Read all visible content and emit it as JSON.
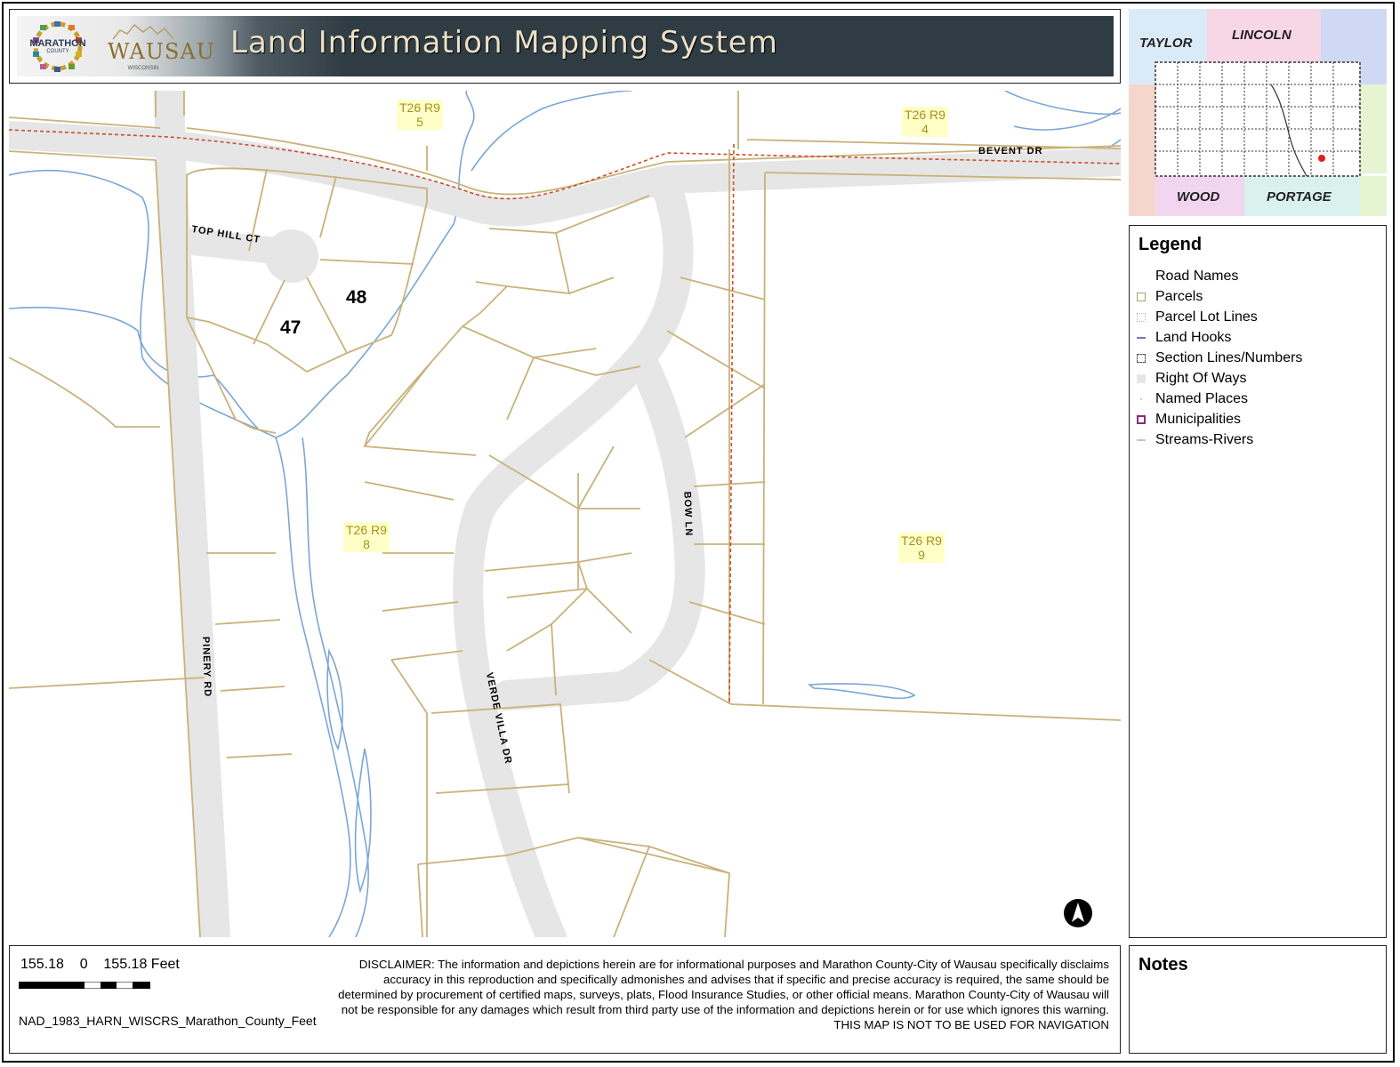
{
  "header": {
    "title": "Land Information Mapping System",
    "logo_marathon": "MARATHON",
    "logo_marathon_sub": "COUNTY",
    "logo_wausau": "WAUSAU",
    "logo_wausau_sub": "WISCONSIN"
  },
  "map": {
    "section_labels": [
      {
        "line1": "T26 R9",
        "line2": "5"
      },
      {
        "line1": "T26 R9",
        "line2": "4"
      },
      {
        "line1": "T26 R9",
        "line2": "8"
      },
      {
        "line1": "T26 R9",
        "line2": "9"
      }
    ],
    "road_labels": [
      "TOP HILL CT",
      "BEVENT DR",
      "BOW LN",
      "PINERY RD",
      "VERDE VILLA DR"
    ],
    "lot_numbers": [
      "48",
      "47"
    ]
  },
  "locator": {
    "counties": [
      "TAYLOR",
      "LINCOLN",
      "WOOD",
      "PORTAGE"
    ]
  },
  "legend": {
    "title": "Legend",
    "items": [
      {
        "label": "Road Names",
        "color": "#ffffff"
      },
      {
        "label": "Parcels",
        "color": "#c9b27a"
      },
      {
        "label": "Parcel Lot Lines",
        "color": "#dddddd"
      },
      {
        "label": "Land Hooks",
        "color": "#7a7aa8"
      },
      {
        "label": "Section Lines/Numbers",
        "color": "#888888"
      },
      {
        "label": "Right Of Ways",
        "color": "#e6e6e6"
      },
      {
        "label": "Named Places",
        "color": "#ffffff"
      },
      {
        "label": "Municipalities",
        "color": "#8b2a7a"
      },
      {
        "label": "Streams-Rivers",
        "color": "#b8c8dd"
      }
    ]
  },
  "scale": {
    "left": "155.18",
    "zero": "0",
    "right": "155.18",
    "unit": "Feet",
    "projection": "NAD_1983_HARN_WISCRS_Marathon_County_Feet"
  },
  "disclaimer": {
    "text": "DISCLAIMER: The information and depictions herein are for informational purposes and Marathon County-City of Wausau specifically disclaims accuracy in this reproduction and specifically admonishes and advises that if specific and precise accuracy is required, the same should be determined by procurement of certified maps, surveys, plats, Flood Insurance Studies, or other official means. Marathon County-City of Wausau will not be responsible for any damages which result from third party use of the information and depictions herein or for use which ignores this warning.",
    "warning": "THIS MAP IS NOT TO BE USED FOR NAVIGATION"
  },
  "notes": {
    "title": "Notes"
  },
  "colors": {
    "parcel_line": "#c9b27a",
    "right_of_way": "#e6e6e6",
    "stream": "#7aa6d6",
    "section_line": "#c8502c",
    "location_dot": "#e02020"
  }
}
